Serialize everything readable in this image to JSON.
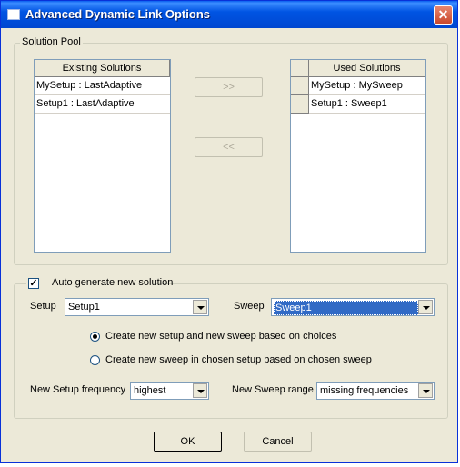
{
  "window": {
    "title": "Advanced Dynamic Link Options",
    "close_glyph": "✕"
  },
  "solution_pool": {
    "legend": "Solution Pool",
    "existing": {
      "header": "Existing Solutions",
      "items": [
        "MySetup : LastAdaptive",
        "Setup1 : LastAdaptive"
      ]
    },
    "used": {
      "header": "Used Solutions",
      "items": [
        "MySetup : MySweep",
        "Setup1 : Sweep1"
      ]
    },
    "add_label": ">>",
    "remove_label": "<<"
  },
  "auto_generate": {
    "label": "Auto generate new solution",
    "checked": true,
    "check_glyph": "✓",
    "setup_label": "Setup",
    "setup_value": "Setup1",
    "sweep_label": "Sweep",
    "sweep_value": "Sweep1",
    "option_new_setup": "Create new setup and new sweep based on choices",
    "option_new_sweep": "Create new sweep in chosen setup based on chosen sweep",
    "selected_option": "new_setup",
    "setup_freq_label": "New Setup frequency",
    "setup_freq_value": "highest",
    "sweep_range_label": "New Sweep range",
    "sweep_range_value": "missing frequencies"
  },
  "buttons": {
    "ok": "OK",
    "cancel": "Cancel"
  }
}
